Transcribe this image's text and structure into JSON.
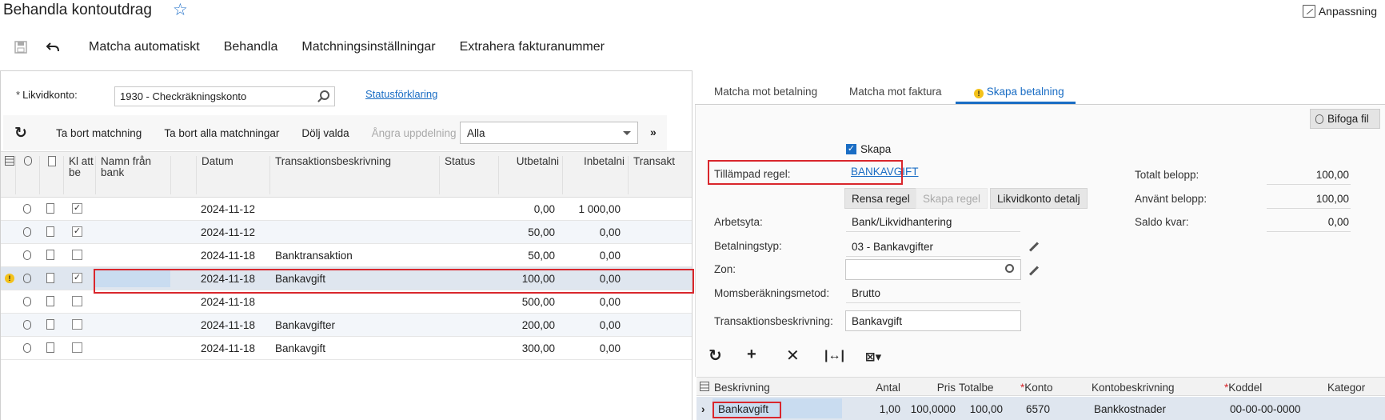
{
  "header": {
    "title": "Behandla kontoutdrag",
    "customize": "Anpassning"
  },
  "toolbar": {
    "items": [
      "Matcha automatiskt",
      "Behandla",
      "Matchningsinställningar",
      "Extrahera fakturanummer"
    ]
  },
  "left": {
    "account_label": "Likvidkonto:",
    "account_value": "1930 - Checkräkningskonto",
    "status_link": "Statusförklaring",
    "actions": [
      "Ta bort matchning",
      "Ta bort alla matchningar",
      "Dölj valda",
      "Ångra uppdelning"
    ],
    "filter_value": "Alla",
    "columns": [
      "Kl att be",
      "Namn från bank",
      "Datum",
      "Transaktionsbeskrivning",
      "Status",
      "Utbetalni",
      "Inbetalni",
      "Transakt"
    ],
    "rows": [
      {
        "checked": true,
        "date": "2024-11-12",
        "desc": "",
        "out": "0,00",
        "in": "1 000,00"
      },
      {
        "checked": true,
        "date": "2024-11-12",
        "desc": "",
        "out": "50,00",
        "in": "0,00"
      },
      {
        "checked": false,
        "date": "2024-11-18",
        "desc": "Banktransaktion",
        "out": "50,00",
        "in": "0,00"
      },
      {
        "checked": true,
        "date": "2024-11-18",
        "desc": "Bankavgift",
        "out": "100,00",
        "in": "0,00"
      },
      {
        "checked": false,
        "date": "2024-11-18",
        "desc": "",
        "out": "500,00",
        "in": "0,00"
      },
      {
        "checked": false,
        "date": "2024-11-18",
        "desc": "Bankavgifter",
        "out": "200,00",
        "in": "0,00"
      },
      {
        "checked": false,
        "date": "2024-11-18",
        "desc": "Bankavgift",
        "out": "300,00",
        "in": "0,00"
      }
    ]
  },
  "right": {
    "tabs": [
      "Matcha mot betalning",
      "Matcha mot faktura",
      "Skapa betalning"
    ],
    "attach": "Bifoga fil",
    "create_label": "Skapa",
    "rule_label": "Tillämpad regel:",
    "rule_value": "BANKAVGIFT",
    "buttons": [
      "Rensa regel",
      "Skapa regel",
      "Likvidkonto detalj"
    ],
    "fields": {
      "arbetsyta_label": "Arbetsyta:",
      "arbetsyta": "Bank/Likvidhantering",
      "betalningstyp_label": "Betalningstyp:",
      "betalningstyp": "03 - Bankavgifter",
      "zon_label": "Zon:",
      "moms_label": "Momsberäkningsmetod:",
      "moms": "Brutto",
      "trans_label": "Transaktionsbeskrivning:",
      "trans": "Bankavgift"
    },
    "totals": {
      "totalt_label": "Totalt belopp:",
      "totalt": "100,00",
      "anvant_label": "Använt belopp:",
      "anvant": "100,00",
      "saldo_label": "Saldo kvar:",
      "saldo": "0,00"
    },
    "grid_columns": [
      "Beskrivning",
      "Antal",
      "Pris",
      "Totalbe",
      "Konto",
      "Kontobeskrivning",
      "Koddel",
      "Kategor"
    ],
    "grid_row": {
      "beskrivning": "Bankavgift",
      "antal": "1,00",
      "pris": "100,0000",
      "total": "100,00",
      "konto": "6570",
      "kontobeskrivning": "Bankkostnader",
      "koddel": "00-00-00-0000"
    }
  }
}
